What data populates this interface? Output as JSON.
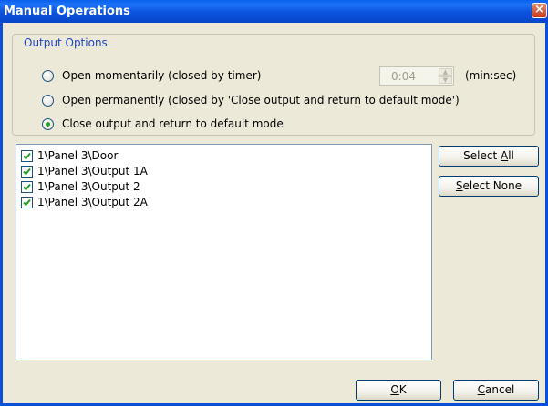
{
  "window": {
    "title": "Manual Operations",
    "close_glyph": "×"
  },
  "output_options": {
    "legend": "Output Options",
    "radios": [
      {
        "label": "Open momentarily (closed by timer)",
        "checked": false
      },
      {
        "label": "Open permanently (closed by 'Close output and return to default mode')",
        "checked": false
      },
      {
        "label": "Close output and return to default mode",
        "checked": true
      }
    ],
    "timer": {
      "value": "0:04",
      "unit": "(min:sec)",
      "enabled": false
    }
  },
  "outputs_list": {
    "items": [
      {
        "label": "1\\Panel 3\\Door",
        "checked": true
      },
      {
        "label": "1\\Panel 3\\Output 1A",
        "checked": true
      },
      {
        "label": "1\\Panel 3\\Output 2",
        "checked": true
      },
      {
        "label": "1\\Panel 3\\Output 2A",
        "checked": true
      }
    ]
  },
  "buttons": {
    "select_all": {
      "pre": "Select ",
      "mnemonic": "A",
      "post": "ll"
    },
    "select_none": {
      "pre": "",
      "mnemonic": "S",
      "post": "elect None"
    },
    "ok": {
      "pre": "",
      "mnemonic": "O",
      "post": "K"
    },
    "cancel": {
      "pre": "",
      "mnemonic": "C",
      "post": "ancel"
    }
  },
  "colors": {
    "titlebar": "#0a5fee",
    "client": "#ece9d8",
    "legend": "#1f45c3",
    "check": "#21a121"
  }
}
